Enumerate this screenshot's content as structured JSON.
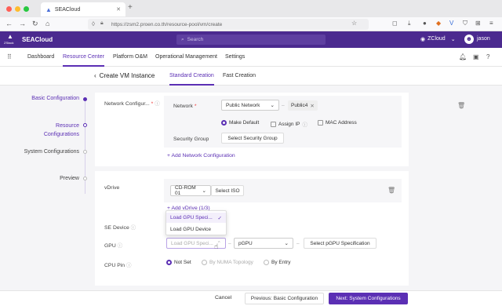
{
  "browser": {
    "tab_title": "SEACloud",
    "url": "https://zsm2.proen.co.th/resource-pool/vm/create"
  },
  "app": {
    "brand": "SEACloud",
    "logo_caption": "ZStack",
    "search_placeholder": "Search",
    "zone": "ZCloud",
    "user": "jason"
  },
  "nav": {
    "items": [
      "Dashboard",
      "Resource Center",
      "Platform O&M",
      "Operational Management",
      "Settings"
    ]
  },
  "sub": {
    "back_title": "Create VM Instance",
    "tabs": [
      "Standard Creation",
      "Fast Creation"
    ]
  },
  "steps": [
    "Basic Configuration",
    "Resource Configurations",
    "System Configurations",
    "Preview"
  ],
  "network": {
    "section_label": "Network Configur...",
    "network_label": "Network",
    "network_select": "Public Network",
    "network_tag": "Public4",
    "make_default": "Make Default",
    "assign_ip": "Assign IP",
    "mac_address": "MAC Address",
    "security_group_label": "Security Group",
    "security_group_button": "Select Security Group",
    "add_network": "+ Add Network Configuration"
  },
  "vdrive": {
    "label": "vDrive",
    "cdrom_select": "CD-ROM 01",
    "select_iso": "Select ISO",
    "add_vdrive": "+ Add vDrive (1/3)"
  },
  "se_device": {
    "label": "SE Device"
  },
  "gpu": {
    "label": "GPU",
    "dropdown_options": [
      "Load GPU Speci...",
      "Load GPU Device"
    ],
    "select_placeholder": "Load GPU Speci...",
    "pgpu_select": "pGPU",
    "pgpu_spec_button": "Select pGPU Specification"
  },
  "cpu_pin": {
    "label": "CPU Pin",
    "options": [
      "Not Set",
      "By NUMA Topology",
      "By Entry"
    ]
  },
  "footer": {
    "cancel": "Cancel",
    "previous": "Previous: Basic Configuration",
    "next": "Next: System Configurations"
  },
  "colors": {
    "accent": "#5b2fb4",
    "header": "#4b2a8f"
  }
}
